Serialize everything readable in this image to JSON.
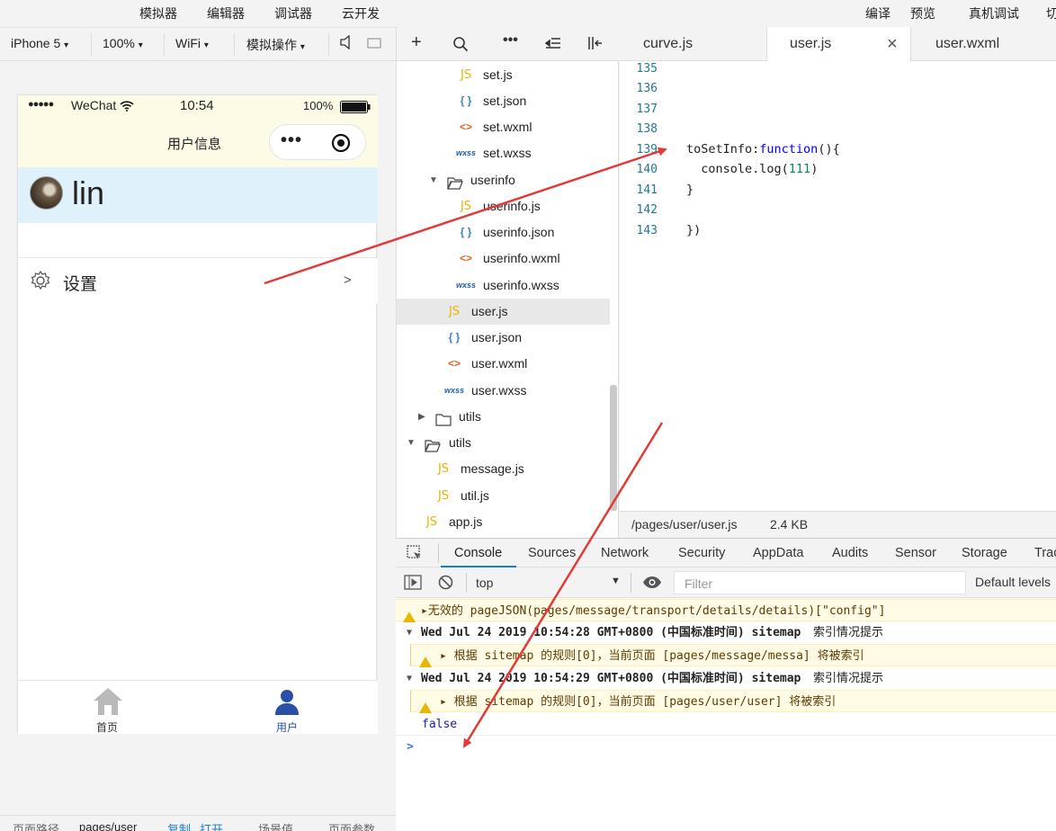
{
  "menubar": {
    "items": [
      "模拟器",
      "编辑器",
      "调试器",
      "云开发"
    ],
    "right_items": [
      "编译",
      "预览",
      "真机调试",
      "切"
    ]
  },
  "simulator_toolbar": {
    "device": "iPhone 5",
    "zoom": "100%",
    "network": "WiFi",
    "operation": "模拟操作"
  },
  "phone": {
    "status": {
      "signal": "●●●●●",
      "carrier": "WeChat",
      "time": "10:54",
      "battery": "100%"
    },
    "nav_title": "用户信息",
    "capsule_dots": "•••",
    "username": "lin",
    "settings_label": "设置",
    "settings_arrow": ">",
    "tabs": [
      {
        "label": "首页",
        "icon": "home-icon",
        "active": false
      },
      {
        "label": "用户",
        "icon": "user-icon",
        "active": true
      }
    ]
  },
  "bottom_status": {
    "path_label": "页面路径",
    "path": "pages/user",
    "copy": "复制",
    "open": "打开",
    "scene": "场景值",
    "params": "页面参数"
  },
  "explorer": {
    "items": [
      {
        "name": "set.js",
        "type": "js",
        "depth": 3
      },
      {
        "name": "set.json",
        "type": "json",
        "depth": 3
      },
      {
        "name": "set.wxml",
        "type": "wxml",
        "depth": 3
      },
      {
        "name": "set.wxss",
        "type": "wxss",
        "depth": 3
      },
      {
        "name": "userinfo",
        "type": "folder-open",
        "depth": 2
      },
      {
        "name": "userinfo.js",
        "type": "js",
        "depth": 3
      },
      {
        "name": "userinfo.json",
        "type": "json",
        "depth": 3
      },
      {
        "name": "userinfo.wxml",
        "type": "wxml",
        "depth": 3
      },
      {
        "name": "userinfo.wxss",
        "type": "wxss",
        "depth": 3
      },
      {
        "name": "user.js",
        "type": "js",
        "depth": 2,
        "selected": true
      },
      {
        "name": "user.json",
        "type": "json",
        "depth": 2
      },
      {
        "name": "user.wxml",
        "type": "wxml",
        "depth": 2
      },
      {
        "name": "user.wxss",
        "type": "wxss",
        "depth": 2
      },
      {
        "name": "utils",
        "type": "folder-closed",
        "depth": 1
      },
      {
        "name": "utils",
        "type": "folder-open",
        "depth": 0
      },
      {
        "name": "message.js",
        "type": "js",
        "depth": 1
      },
      {
        "name": "util.js",
        "type": "js",
        "depth": 1
      },
      {
        "name": "app.js",
        "type": "js",
        "depth": 0
      }
    ]
  },
  "editor": {
    "tabs": [
      {
        "name": "curve.js",
        "active": false
      },
      {
        "name": "user.js",
        "active": true,
        "close": "×"
      },
      {
        "name": "user.wxml",
        "active": false
      }
    ],
    "line_numbers": [
      "135",
      "136",
      "137",
      "138",
      "139",
      "140",
      "141",
      "142",
      "143"
    ],
    "lines": {
      "l139_name": "toSetInfo:",
      "l139_kw": "function",
      "l139_rest": "(){",
      "l140_pre": "  console.log(",
      "l140_num": "111",
      "l140_post": ")",
      "l141": "}",
      "l143": "})"
    },
    "file_path": "/pages/user/user.js",
    "file_size": "2.4 KB"
  },
  "devtools": {
    "tabs": [
      "Console",
      "Sources",
      "Network",
      "Security",
      "AppData",
      "Audits",
      "Sensor",
      "Storage",
      "Trac"
    ],
    "active_tab": "Console",
    "context": "top",
    "filter_placeholder": "Filter",
    "levels": "Default levels"
  },
  "console": {
    "l1": "▸无效的 pageJSON(pages/message/transport/details/details)[\"config\"]",
    "l2_prefix": "Wed Jul 24 2019 10:54:28 GMT+0800 (中国标准时间) sitemap",
    "l2_suffix": " 索引情况提示",
    "l3": "▸ 根据 sitemap 的规则[0]，当前页面 [pages/message/messa] 将被索引",
    "l4_prefix": "Wed Jul 24 2019 10:54:29 GMT+0800 (中国标准时间) sitemap",
    "l4_suffix": " 索引情况提示",
    "l5": "▸ 根据 sitemap 的规则[0]，当前页面 [pages/user/user] 将被索引",
    "l6": "false",
    "prompt": ">"
  },
  "colors": {
    "accent": "#1b7ec4",
    "arrow": "#e23a36",
    "user_tab": "#2850a8",
    "home_tab": "#b9b9b9"
  }
}
